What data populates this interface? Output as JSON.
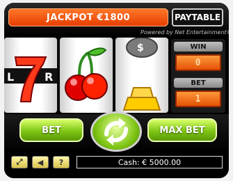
{
  "header": {
    "jackpot_text": "JACKPOT €1800",
    "paytable_label": "PAYTABLE",
    "powered_by": "Powered by Net Entertainment®"
  },
  "reels": {
    "reel1": {
      "symbol": "seven-bar-icon",
      "partial_text": "R"
    },
    "reel2": {
      "symbol": "cherry-icon"
    },
    "reel3": {
      "symbols": [
        "money-bag-icon",
        "gold-bar-icon"
      ]
    }
  },
  "side_panel": {
    "win_label": "WIN",
    "win_value": "0",
    "bet_label": "BET",
    "bet_value": "1"
  },
  "controls": {
    "bet_label": "BET",
    "max_bet_label": "MAX BET",
    "spin_icon": "spin-arrows-icon"
  },
  "bottom": {
    "cash_text": "Cash: € 5000.00",
    "help_label": "?",
    "sound_icon": "sound-icon",
    "fullscreen_icon": "expand-icon"
  },
  "colors": {
    "jackpot_orange": "#ff6a1a",
    "button_green": "#7fc515",
    "digits_orange": "#ff8a2a"
  }
}
